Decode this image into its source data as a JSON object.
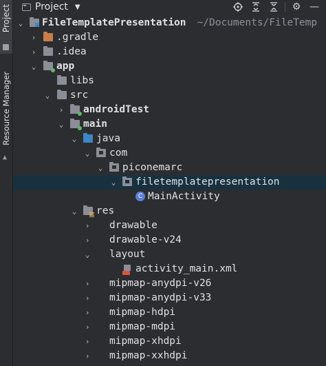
{
  "side_tabs": {
    "project": "Project",
    "resource_manager": "Resource Manager"
  },
  "header": {
    "title": "Project"
  },
  "tree": [
    {
      "label": "FileTemplatePresentation",
      "suffix": "~/Documents/FileTemp",
      "bold": true
    },
    {
      "label": ".gradle"
    },
    {
      "label": ".idea"
    },
    {
      "label": "app",
      "bold": true
    },
    {
      "label": "libs"
    },
    {
      "label": "src"
    },
    {
      "label": "androidTest",
      "bold": true
    },
    {
      "label": "main",
      "bold": true
    },
    {
      "label": "java"
    },
    {
      "label": "com"
    },
    {
      "label": "piconemarc"
    },
    {
      "label": "filetemplatepresentation",
      "selected": true
    },
    {
      "label": "MainActivity"
    },
    {
      "label": "res"
    },
    {
      "label": "drawable"
    },
    {
      "label": "drawable-v24"
    },
    {
      "label": "layout"
    },
    {
      "label": "activity_main.xml"
    },
    {
      "label": "mipmap-anydpi-v26"
    },
    {
      "label": "mipmap-anydpi-v33"
    },
    {
      "label": "mipmap-hdpi"
    },
    {
      "label": "mipmap-mdpi"
    },
    {
      "label": "mipmap-xhdpi"
    },
    {
      "label": "mipmap-xxhdpi"
    }
  ],
  "icons": {
    "header": [
      "locate-icon",
      "expand-all-icon",
      "collapse-all-icon",
      "settings-icon",
      "minimize-icon"
    ]
  },
  "colors": {
    "background": "#2b2d30",
    "selection": "#18313f",
    "folder": "#8b8e96",
    "source_folder": "#3e86c4",
    "excluded_folder": "#c97d4b"
  }
}
